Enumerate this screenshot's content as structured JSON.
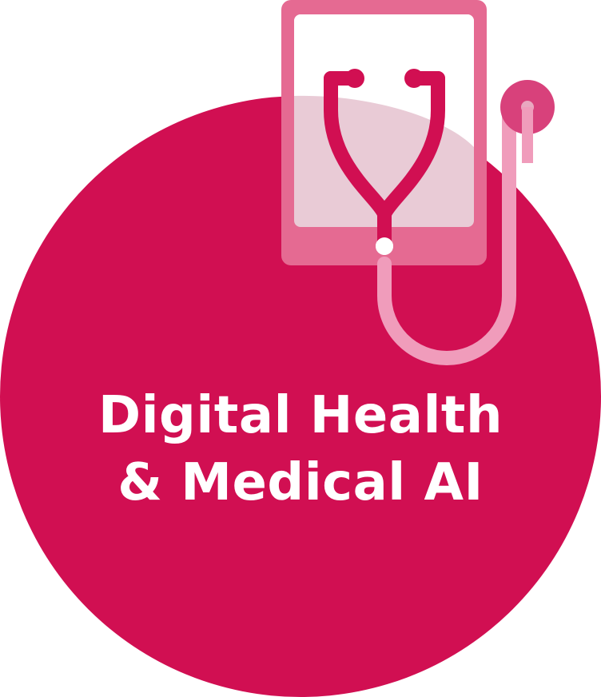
{
  "badge": {
    "title_line1": "Digital Health",
    "title_line2": "& Medical AI",
    "icons": [
      "tablet-icon",
      "stethoscope-icon"
    ]
  },
  "colors": {
    "circle": "#d10f52",
    "tablet_frame": "#e56a92",
    "tablet_screen": "#e9cbd6",
    "stethoscope_primary": "#d10f52",
    "tube_light": "#f09cbb",
    "chest_piece": "#d8417b",
    "text": "#ffffff"
  }
}
